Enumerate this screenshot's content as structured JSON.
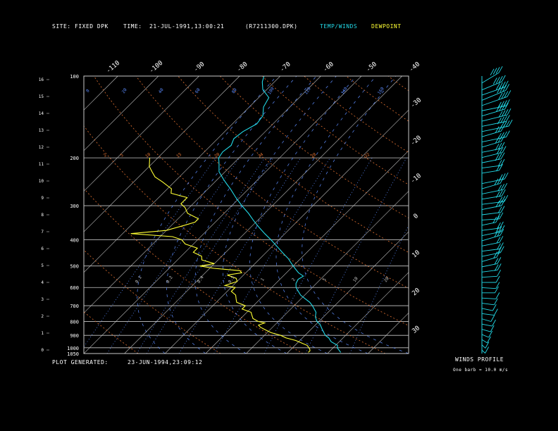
{
  "header": {
    "site_label": "SITE:",
    "site_value": "FIXED DPK",
    "time_label": "TIME:",
    "time_value": "21-JUL-1991,13:00:21",
    "file_id": "(R7211300.DPK)",
    "legend_temp": "TEMP/WINDS",
    "legend_dew": "DEWPOINT"
  },
  "footer": {
    "generated_label": "PLOT GENERATED:",
    "generated_value": "23-JUN-1994,23:09:12"
  },
  "winds_panel": {
    "title": "WINDS PROFILE",
    "note": "One barb = 10.0 m/s"
  },
  "colors": {
    "temp": "#22d8e6",
    "dewpoint": "#ffff33",
    "isotherm": "#c8c8c8",
    "isobar": "#c8c8c8",
    "mixing_ratio": "#5c8cff",
    "dry_adiabat": "#e07030",
    "moist_adiabat": "#5c8cff",
    "frame": "#c8c8c8",
    "text": "#ffffff"
  },
  "chart_data": {
    "type": "line",
    "chart_kind": "skew-T log-P sounding",
    "pressure_levels": [
      100,
      200,
      300,
      400,
      500,
      600,
      700,
      800,
      900,
      1000,
      1050
    ],
    "height_ticks": [
      "16",
      "15",
      "14",
      "13",
      "12",
      "11",
      "10",
      "9",
      "8",
      "7",
      "6",
      "5",
      "4",
      "3",
      "2",
      "1",
      "0"
    ],
    "top_temp_labels": [
      "-110",
      "-100",
      "-90",
      "-80",
      "-70",
      "-60",
      "-50",
      "-40"
    ],
    "right_temp_labels": [
      "-30",
      "-20",
      "-10",
      "0",
      "10",
      "20",
      "30"
    ],
    "mixing_ratio_labels": [
      "20",
      "10",
      "5",
      "2",
      "1",
      "0.5",
      "0.4",
      "0.2",
      "0.1"
    ],
    "dry_adiabat_labels": [
      "0",
      "20",
      "40",
      "60",
      "80",
      "100",
      "120",
      "140",
      "160"
    ],
    "series": [
      {
        "name": "TEMP/WINDS",
        "points": [
          {
            "p": 1040,
            "t": 23
          },
          {
            "p": 1020,
            "t": 22
          },
          {
            "p": 1000,
            "t": 21
          },
          {
            "p": 980,
            "t": 20.5
          },
          {
            "p": 950,
            "t": 18
          },
          {
            "p": 920,
            "t": 16.5
          },
          {
            "p": 900,
            "t": 15
          },
          {
            "p": 870,
            "t": 13.5
          },
          {
            "p": 850,
            "t": 12.5
          },
          {
            "p": 820,
            "t": 11
          },
          {
            "p": 800,
            "t": 9.5
          },
          {
            "p": 770,
            "t": 8
          },
          {
            "p": 740,
            "t": 7
          },
          {
            "p": 700,
            "t": 4.5
          },
          {
            "p": 680,
            "t": 3
          },
          {
            "p": 660,
            "t": 1
          },
          {
            "p": 640,
            "t": -1
          },
          {
            "p": 620,
            "t": -2.5
          },
          {
            "p": 600,
            "t": -4
          },
          {
            "p": 580,
            "t": -5
          },
          {
            "p": 560,
            "t": -5.5
          },
          {
            "p": 545,
            "t": -5
          },
          {
            "p": 530,
            "t": -7
          },
          {
            "p": 510,
            "t": -9
          },
          {
            "p": 490,
            "t": -11
          },
          {
            "p": 470,
            "t": -13
          },
          {
            "p": 450,
            "t": -15.5
          },
          {
            "p": 430,
            "t": -18
          },
          {
            "p": 400,
            "t": -22
          },
          {
            "p": 380,
            "t": -25
          },
          {
            "p": 360,
            "t": -28
          },
          {
            "p": 340,
            "t": -31
          },
          {
            "p": 320,
            "t": -34
          },
          {
            "p": 300,
            "t": -37.5
          },
          {
            "p": 280,
            "t": -41
          },
          {
            "p": 260,
            "t": -44.5
          },
          {
            "p": 250,
            "t": -46.5
          },
          {
            "p": 240,
            "t": -48.5
          },
          {
            "p": 225,
            "t": -51.5
          },
          {
            "p": 210,
            "t": -53.5
          },
          {
            "p": 200,
            "t": -55
          },
          {
            "p": 190,
            "t": -55.5
          },
          {
            "p": 180,
            "t": -55
          },
          {
            "p": 170,
            "t": -56
          },
          {
            "p": 160,
            "t": -55.5
          },
          {
            "p": 150,
            "t": -54
          },
          {
            "p": 140,
            "t": -54.5
          },
          {
            "p": 130,
            "t": -56.5
          },
          {
            "p": 120,
            "t": -57.5
          },
          {
            "p": 112,
            "t": -61
          },
          {
            "p": 105,
            "t": -63
          },
          {
            "p": 100,
            "t": -64
          }
        ]
      },
      {
        "name": "DEWPOINT",
        "points": [
          {
            "p": 1040,
            "t": 15
          },
          {
            "p": 1025,
            "t": 15
          },
          {
            "p": 1010,
            "t": 14.5
          },
          {
            "p": 1000,
            "t": 14
          },
          {
            "p": 980,
            "t": 13
          },
          {
            "p": 960,
            "t": 11
          },
          {
            "p": 940,
            "t": 9
          },
          {
            "p": 920,
            "t": 6
          },
          {
            "p": 900,
            "t": 4
          },
          {
            "p": 880,
            "t": 1
          },
          {
            "p": 860,
            "t": -1
          },
          {
            "p": 840,
            "t": -3
          },
          {
            "p": 825,
            "t": -4
          },
          {
            "p": 810,
            "t": -3
          },
          {
            "p": 800,
            "t": -5
          },
          {
            "p": 780,
            "t": -7
          },
          {
            "p": 760,
            "t": -8
          },
          {
            "p": 740,
            "t": -9
          },
          {
            "p": 720,
            "t": -12
          },
          {
            "p": 700,
            "t": -12
          },
          {
            "p": 680,
            "t": -15
          },
          {
            "p": 660,
            "t": -16
          },
          {
            "p": 640,
            "t": -17
          },
          {
            "p": 620,
            "t": -19
          },
          {
            "p": 600,
            "t": -19
          },
          {
            "p": 590,
            "t": -22
          },
          {
            "p": 570,
            "t": -20
          },
          {
            "p": 555,
            "t": -21
          },
          {
            "p": 540,
            "t": -24
          },
          {
            "p": 530,
            "t": -21
          },
          {
            "p": 520,
            "t": -22
          },
          {
            "p": 510,
            "t": -29
          },
          {
            "p": 500,
            "t": -33
          },
          {
            "p": 490,
            "t": -30
          },
          {
            "p": 475,
            "t": -34
          },
          {
            "p": 460,
            "t": -35
          },
          {
            "p": 445,
            "t": -38
          },
          {
            "p": 430,
            "t": -38
          },
          {
            "p": 415,
            "t": -42
          },
          {
            "p": 400,
            "t": -44
          },
          {
            "p": 390,
            "t": -47
          },
          {
            "p": 380,
            "t": -58
          },
          {
            "p": 370,
            "t": -50
          },
          {
            "p": 355,
            "t": -47
          },
          {
            "p": 345,
            "t": -45
          },
          {
            "p": 335,
            "t": -45
          },
          {
            "p": 320,
            "t": -49
          },
          {
            "p": 305,
            "t": -51
          },
          {
            "p": 295,
            "t": -53
          },
          {
            "p": 280,
            "t": -53
          },
          {
            "p": 270,
            "t": -58
          },
          {
            "p": 260,
            "t": -59
          },
          {
            "p": 245,
            "t": -63
          },
          {
            "p": 235,
            "t": -66
          },
          {
            "p": 225,
            "t": -68
          },
          {
            "p": 215,
            "t": -70
          },
          {
            "p": 200,
            "t": -72
          }
        ]
      }
    ],
    "xlim": [
      -40,
      40
    ],
    "ylim": [
      1050,
      100
    ],
    "y_scale": "log",
    "winds": [
      {
        "h": 15.6,
        "dir": 330,
        "spd": 45
      },
      {
        "h": 15.2,
        "dir": 320,
        "spd": 40
      },
      {
        "h": 14.9,
        "dir": 315,
        "spd": 42
      },
      {
        "h": 14.6,
        "dir": 320,
        "spd": 50
      },
      {
        "h": 14.3,
        "dir": 315,
        "spd": 48
      },
      {
        "h": 14.0,
        "dir": 300,
        "spd": 35
      },
      {
        "h": 13.7,
        "dir": 310,
        "spd": 38
      },
      {
        "h": 13.4,
        "dir": 305,
        "spd": 40
      },
      {
        "h": 13.1,
        "dir": 300,
        "spd": 35
      },
      {
        "h": 12.8,
        "dir": 300,
        "spd": 40
      },
      {
        "h": 12.5,
        "dir": 310,
        "spd": 30
      },
      {
        "h": 12.2,
        "dir": 300,
        "spd": 35
      },
      {
        "h": 11.9,
        "dir": 310,
        "spd": 30
      },
      {
        "h": 11.6,
        "dir": 300,
        "spd": 25
      },
      {
        "h": 11.3,
        "dir": 305,
        "spd": 30
      },
      {
        "h": 11.0,
        "dir": 300,
        "spd": 25
      },
      {
        "h": 10.7,
        "dir": 290,
        "spd": 22
      },
      {
        "h": 10.4,
        "dir": 295,
        "spd": 20
      },
      {
        "h": 9.8,
        "dir": 300,
        "spd": 32
      },
      {
        "h": 9.5,
        "dir": 310,
        "spd": 28
      },
      {
        "h": 9.2,
        "dir": 300,
        "spd": 30
      },
      {
        "h": 8.9,
        "dir": 295,
        "spd": 25
      },
      {
        "h": 8.6,
        "dir": 290,
        "spd": 28
      },
      {
        "h": 8.3,
        "dir": 300,
        "spd": 26
      },
      {
        "h": 8.0,
        "dir": 290,
        "spd": 22
      },
      {
        "h": 7.7,
        "dir": 280,
        "spd": 18
      },
      {
        "h": 7.4,
        "dir": 300,
        "spd": 15
      },
      {
        "h": 7.1,
        "dir": 290,
        "spd": 20
      },
      {
        "h": 6.8,
        "dir": 300,
        "spd": 25
      },
      {
        "h": 6.5,
        "dir": 310,
        "spd": 28
      },
      {
        "h": 6.2,
        "dir": 300,
        "spd": 22
      },
      {
        "h": 5.9,
        "dir": 290,
        "spd": 20
      },
      {
        "h": 5.6,
        "dir": 300,
        "spd": 24
      },
      {
        "h": 5.3,
        "dir": 310,
        "spd": 20
      },
      {
        "h": 5.0,
        "dir": 300,
        "spd": 18
      },
      {
        "h": 4.7,
        "dir": 290,
        "spd": 16
      },
      {
        "h": 4.4,
        "dir": 280,
        "spd": 14
      },
      {
        "h": 4.1,
        "dir": 270,
        "spd": 12
      },
      {
        "h": 3.8,
        "dir": 260,
        "spd": 12
      },
      {
        "h": 3.5,
        "dir": 270,
        "spd": 10
      },
      {
        "h": 3.2,
        "dir": 260,
        "spd": 12
      },
      {
        "h": 2.9,
        "dir": 250,
        "spd": 10
      },
      {
        "h": 2.6,
        "dir": 240,
        "spd": 9
      },
      {
        "h": 2.3,
        "dir": 250,
        "spd": 10
      },
      {
        "h": 2.0,
        "dir": 230,
        "spd": 8
      },
      {
        "h": 1.7,
        "dir": 240,
        "spd": 8
      },
      {
        "h": 1.4,
        "dir": 230,
        "spd": 7
      },
      {
        "h": 1.1,
        "dir": 220,
        "spd": 6
      },
      {
        "h": 0.8,
        "dir": 210,
        "spd": 6
      },
      {
        "h": 0.5,
        "dir": 200,
        "spd": 5
      },
      {
        "h": 0.2,
        "dir": 200,
        "spd": 4
      }
    ]
  }
}
